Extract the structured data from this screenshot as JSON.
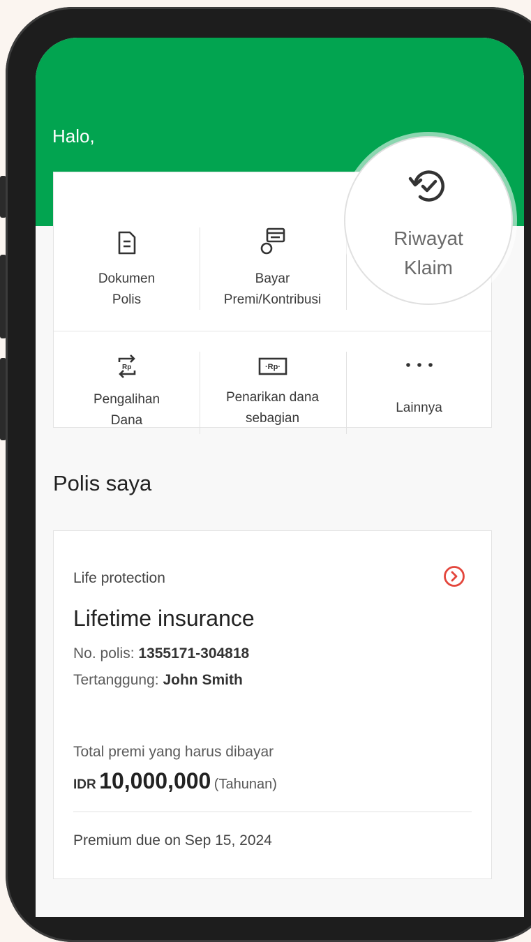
{
  "header": {
    "greeting": "Halo,"
  },
  "menu": {
    "items": [
      {
        "line1": "Dokumen",
        "line2": "Polis",
        "icon": "document-icon"
      },
      {
        "line1": "Bayar",
        "line2": "Premi/Kontribusi",
        "icon": "pay-card-icon"
      },
      {
        "line1": "Pengalihan",
        "line2": "Dana",
        "icon": "fund-switch-icon"
      },
      {
        "line1": "Penarikan dana",
        "line2": "sebagian",
        "icon": "withdrawal-icon"
      },
      {
        "line1": "Lainnya",
        "icon": "more-dots-icon"
      }
    ],
    "highlight": {
      "line1": "Riwayat",
      "line2": "Klaim",
      "icon": "claim-history-icon"
    },
    "withdraw_icon_text": "·Rp·",
    "switch_icon_text": "Rp"
  },
  "policies": {
    "title": "Polis saya",
    "card": {
      "category": "Life protection",
      "name": "Lifetime insurance",
      "policy_no_label": "No. polis:",
      "policy_no": "1355171-304818",
      "insured_label": "Tertanggung:",
      "insured": "John Smith",
      "premium_label": "Total premi yang harus dibayar",
      "currency": "IDR",
      "amount": "10,000,000",
      "period": "(Tahunan)",
      "due_text": "Premium due on Sep 15, 2024"
    }
  },
  "colors": {
    "brand_green": "#02a450",
    "accent_red": "#e3463c"
  }
}
